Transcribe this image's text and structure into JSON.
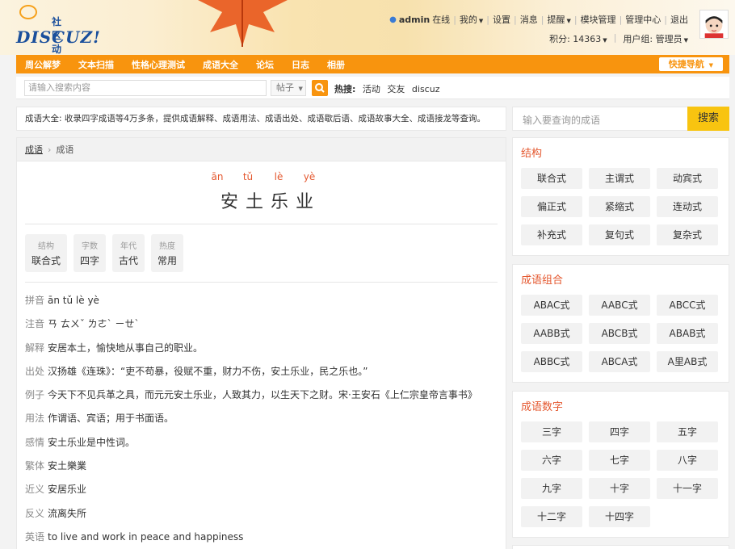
{
  "header": {
    "logo_sub": "社区动力",
    "logo_main": "DISCUZ!",
    "user_nav": {
      "username": "admin",
      "online": "在线",
      "items": [
        "我的",
        "设置",
        "消息",
        "提醒",
        "模块管理",
        "管理中心",
        "退出"
      ]
    },
    "points_label": "积分: 14363",
    "group_label": "用户组: 管理员"
  },
  "main_nav": {
    "items": [
      "周公解梦",
      "文本扫描",
      "性格心理测试",
      "成语大全",
      "论坛",
      "日志",
      "相册"
    ],
    "quick_nav": "快捷导航"
  },
  "search": {
    "placeholder": "请输入搜索内容",
    "type": "帖子",
    "hot_label": "热搜:",
    "hot_items": [
      "活动",
      "交友",
      "discuz"
    ]
  },
  "notice": "成语大全: 收录四字成语等4万多条，提供成语解释、成语用法、成语出处、成语歇后语、成语故事大全、成语接龙等查询。",
  "breadcrumb": {
    "home": "成语",
    "current": "成语"
  },
  "idiom": {
    "pinyin": [
      "ān",
      "tǔ",
      "lè",
      "yè"
    ],
    "word": "安土乐业",
    "tags": [
      {
        "k": "结构",
        "v": "联合式"
      },
      {
        "k": "字数",
        "v": "四字"
      },
      {
        "k": "年代",
        "v": "古代"
      },
      {
        "k": "热度",
        "v": "常用"
      }
    ],
    "details": [
      {
        "label": "拼音",
        "value": "ān tǔ lè yè"
      },
      {
        "label": "注音",
        "value": "ㄢ ㄊㄨˇ ㄌㄜˋ ㄧㄝˋ"
      },
      {
        "label": "解释",
        "value": "安居本土，愉快地从事自己的职业。"
      },
      {
        "label": "出处",
        "value": "汉扬雄《连珠》：“吏不苟暴，役赋不重，财力不伤，安土乐业，民之乐也。”"
      },
      {
        "label": "例子",
        "value": "今天下不见兵革之具，而元元安土乐业，人致其力，以生天下之财。宋·王安石《上仁宗皇帝言事书》"
      },
      {
        "label": "用法",
        "value": "作谓语、宾语；用于书面语。"
      },
      {
        "label": "感情",
        "value": "安土乐业是中性词。"
      },
      {
        "label": "繁体",
        "value": "安土樂業"
      },
      {
        "label": "近义",
        "value": "安居乐业"
      },
      {
        "label": "反义",
        "value": "流离失所"
      },
      {
        "label": "英语",
        "value": "to live and work in peace and happiness"
      }
    ]
  },
  "sidebar": {
    "search_placeholder": "输入要查询的成语",
    "search_button": "搜索",
    "structure": {
      "title": "结构",
      "items": [
        "联合式",
        "主谓式",
        "动宾式",
        "偏正式",
        "紧缩式",
        "连动式",
        "补充式",
        "复句式",
        "复杂式"
      ]
    },
    "combo": {
      "title": "成语组合",
      "items": [
        "ABAC式",
        "AABC式",
        "ABCC式",
        "AABB式",
        "ABCB式",
        "ABAB式",
        "ABBC式",
        "ABCA式",
        "A里AB式"
      ]
    },
    "count": {
      "title": "成语数字",
      "items": [
        "三字",
        "四字",
        "五字",
        "六字",
        "七字",
        "八字",
        "九字",
        "十字",
        "十一字",
        "十二字",
        "十四字"
      ]
    }
  }
}
